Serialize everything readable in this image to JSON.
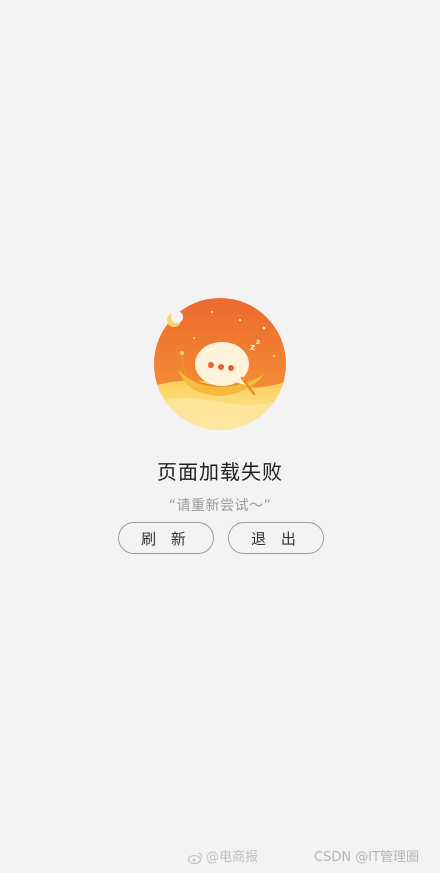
{
  "error": {
    "title": "页面加载失败",
    "subtitle": "“请重新尝试～”"
  },
  "buttons": {
    "refresh": "刷 新",
    "exit": "退 出"
  },
  "watermark": {
    "weibo_handle": "@电商报",
    "csdn": "CSDN @IT管理圈"
  },
  "icons": {
    "illustration": "sleeping-chat-bubble-in-boat-icon",
    "weibo": "weibo-logo-icon"
  },
  "colors": {
    "background": "#f3f3f3",
    "illustration_orange": "#f0722f",
    "illustration_yellow": "#fbd56b",
    "button_border": "#9c9c9c"
  }
}
